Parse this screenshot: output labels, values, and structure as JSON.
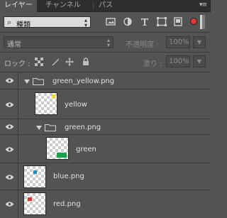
{
  "tabs": [
    {
      "label": "レイヤー",
      "active": true
    },
    {
      "label": "チャンネル",
      "active": false
    },
    {
      "label": "パス",
      "active": false
    }
  ],
  "panel_menu_icon": "panel-menu-icon",
  "filter": {
    "kind_label": "種類",
    "icons": [
      "image-filter-icon",
      "adjustment-filter-icon",
      "type-filter-icon",
      "shape-filter-icon",
      "smart-object-filter-icon"
    ]
  },
  "blend": {
    "mode": "通常",
    "opacity_label": "不透明度 :",
    "opacity_value": "100%"
  },
  "lock": {
    "label": "ロック :",
    "fill_label": "塗り :",
    "fill_value": "100%",
    "icons": [
      "lock-transparent-icon",
      "lock-image-icon",
      "lock-position-icon",
      "lock-all-icon"
    ]
  },
  "layers": [
    {
      "name": "green_yellow.png",
      "type": "group",
      "swatch": "#f2e100"
    },
    {
      "name": "yellow",
      "type": "layer",
      "swatch": "#f2e100"
    },
    {
      "name": "green.png",
      "type": "group",
      "swatch": "#1aa04a"
    },
    {
      "name": "green",
      "type": "layer",
      "swatch": "#1aa04a"
    },
    {
      "name": "blue.png",
      "type": "layer",
      "swatch": "#1d8fd6"
    },
    {
      "name": "red.png",
      "type": "layer",
      "swatch": "#e0392f"
    }
  ],
  "colors": {
    "panel_bg": "#535353",
    "tabbar_bg": "#2e2e2e",
    "filter_toggle": "#e0392f"
  }
}
